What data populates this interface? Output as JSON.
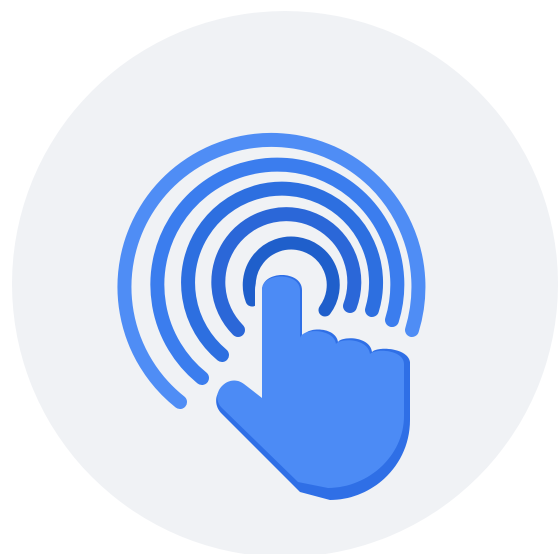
{
  "illustration": {
    "icon": "touch-tap-icon",
    "colors": {
      "background_circle": "#F0F2F5",
      "ring_outer": "#4F8DF5",
      "ring_second": "#3B7DEE",
      "ring_third": "#2D6FE0",
      "ring_inner": "#2B67D8",
      "ring_center": "#1F5FCB",
      "hand_fill": "#4C8BF5",
      "hand_shadow": "#2F6FE6",
      "hand_outline": "#F0F2F5"
    }
  }
}
